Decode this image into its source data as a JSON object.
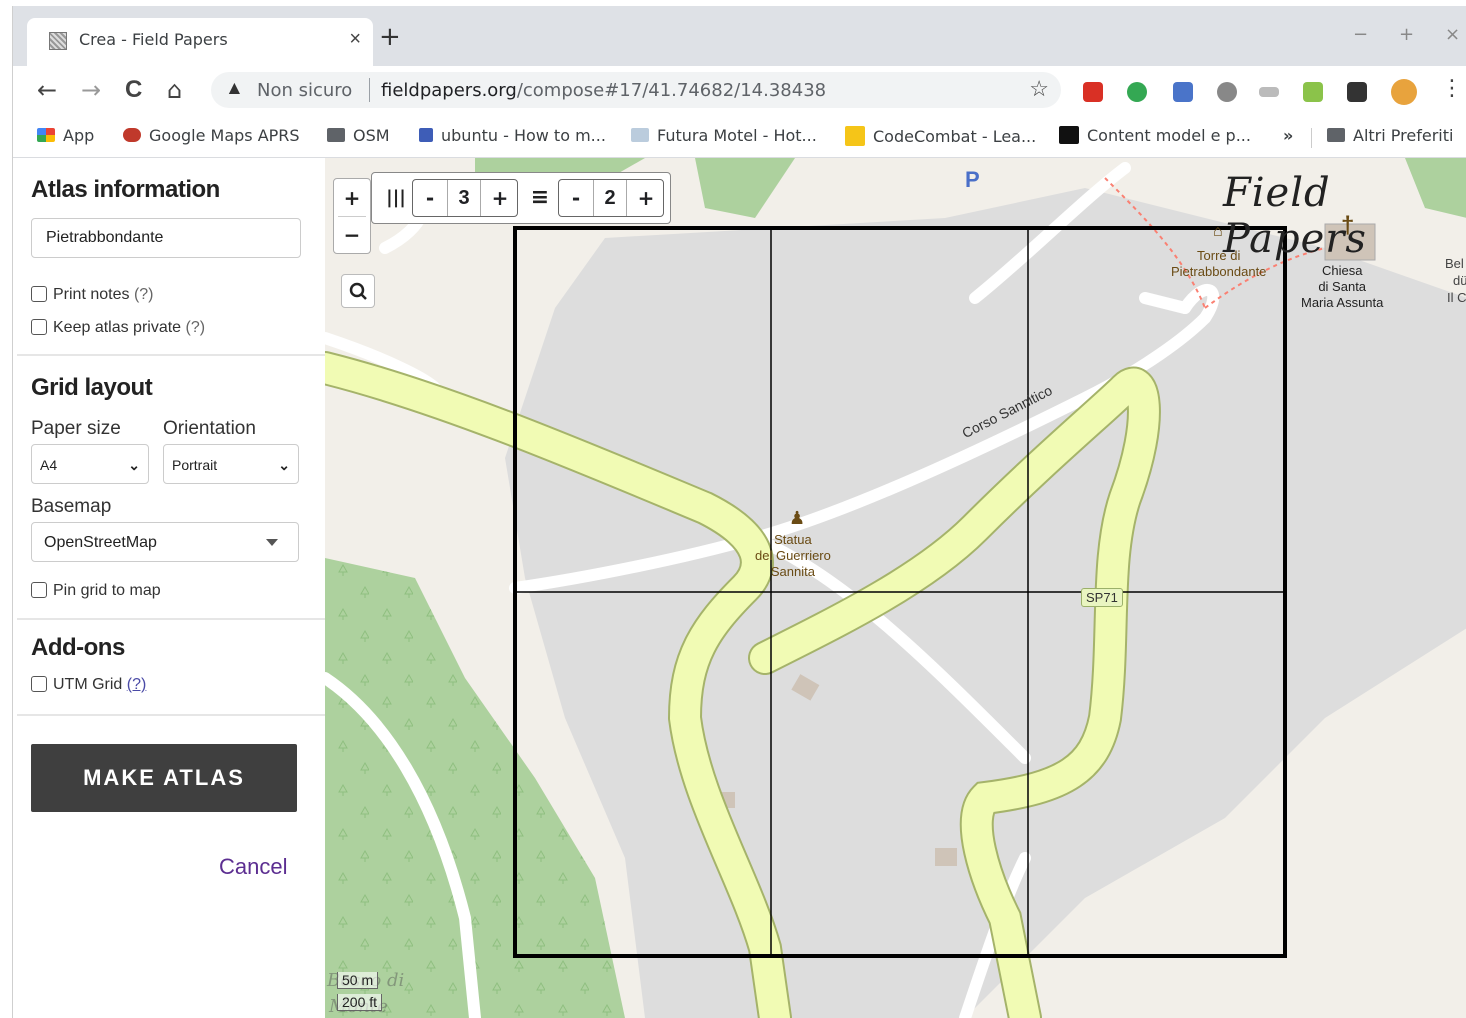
{
  "browser": {
    "tab_title": "Crea - Field Papers",
    "tab_close": "×",
    "new_tab": "+",
    "win_min": "−",
    "win_max": "+",
    "win_close": "×",
    "nav": {
      "back": "←",
      "forward": "→",
      "reload": "C",
      "home": "⌂"
    },
    "security_text": "Non sicuro",
    "url_host": "fieldpapers.org",
    "url_path": "/compose#17/41.74682/14.38438",
    "bookmarks": [
      {
        "label": "App"
      },
      {
        "label": "Google Maps APRS"
      },
      {
        "label": "OSM"
      },
      {
        "label": "ubuntu - How to m..."
      },
      {
        "label": "Futura Motel - Hot..."
      },
      {
        "label": "CodeCombat - Lea..."
      },
      {
        "label": "Content model e p..."
      }
    ],
    "bookmarks_more": "»",
    "other_bookmarks": "Altri Preferiti",
    "colors": {
      "tabstrip": "#dee1e6",
      "omnibox": "#f1f3f4"
    }
  },
  "sidebar": {
    "atlas_info": {
      "heading": "Atlas information",
      "title_value": "Pietrabbondante",
      "print_notes": "Print notes",
      "print_notes_help": "(?)",
      "keep_private": "Keep atlas private",
      "keep_private_help": "(?)"
    },
    "grid_layout": {
      "heading": "Grid layout",
      "paper_size_label": "Paper size",
      "paper_size_value": "A4",
      "orientation_label": "Orientation",
      "orientation_value": "Portrait",
      "basemap_label": "Basemap",
      "basemap_value": "OpenStreetMap",
      "pin_grid": "Pin grid to map"
    },
    "addons": {
      "heading": "Add-ons",
      "utm_grid": "UTM Grid",
      "utm_help": "(?)"
    },
    "make_atlas": "MAKE ATLAS",
    "cancel": "Cancel"
  },
  "map": {
    "zoom_in": "+",
    "zoom_out": "−",
    "search_icon": "search-icon",
    "columns_icon": "|||",
    "rows_icon": "≡",
    "minus": "-",
    "plus": "+",
    "columns": "3",
    "rows": "2",
    "grid_cells": {
      "cols": 3,
      "rows": 2
    },
    "brand": "Field Papers",
    "labels": {
      "parking": "P",
      "tower": "Torre di\nPietrabbondante",
      "church": "Chiesa\ndi Santa\nMaria Assunta",
      "church_cross": "†",
      "statue": "Statua\ndel Guerriero\nSannita",
      "road": "Corso Sannitico",
      "route": "SP71",
      "edge_top": "Bel",
      "edge_mid": "dü",
      "edge_bot": "Il C"
    },
    "scale_metric": "50 m",
    "scale_imperial": "200 ft",
    "faint_text_1": "Bosco di",
    "faint_text_2": "Monte",
    "colors": {
      "land": "#f2efe9",
      "built": "#dddddd",
      "forest": "#add19e",
      "primary_road": "#f1fbb4",
      "primary_casing": "#a5b36a"
    }
  }
}
